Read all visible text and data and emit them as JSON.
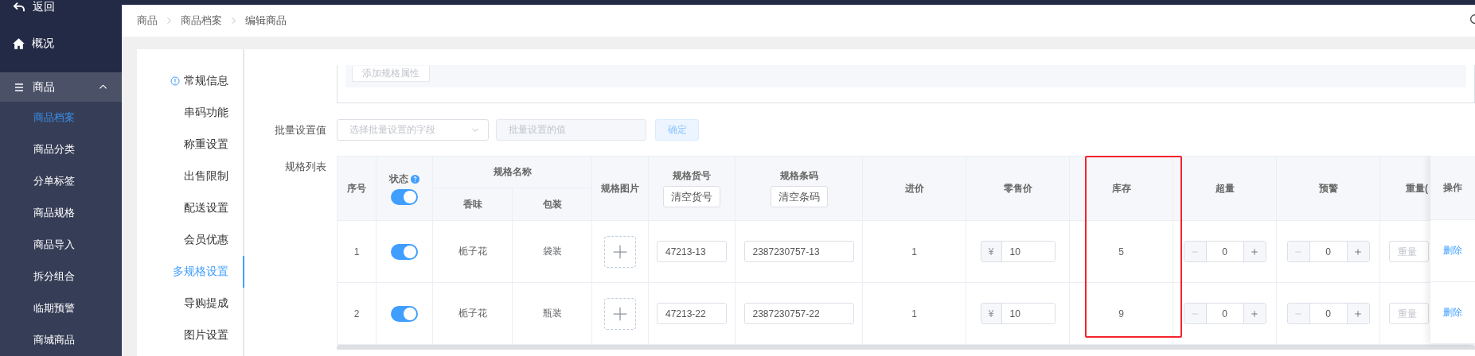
{
  "sidebar": {
    "back": "返回",
    "overview": "概况",
    "group": {
      "label": "商品",
      "expanded": true,
      "items": [
        {
          "label": "商品档案",
          "selected": true
        },
        {
          "label": "商品分类",
          "selected": false
        },
        {
          "label": "分单标签",
          "selected": false
        },
        {
          "label": "商品规格",
          "selected": false
        },
        {
          "label": "商品导入",
          "selected": false
        },
        {
          "label": "拆分组合",
          "selected": false
        },
        {
          "label": "临期预警",
          "selected": false
        },
        {
          "label": "商城商品",
          "selected": false
        }
      ]
    }
  },
  "breadcrumb": [
    "商品",
    "商品档案",
    "编辑商品"
  ],
  "section_nav": [
    {
      "label": "常规信息",
      "selected": false,
      "alert": true
    },
    {
      "label": "串码功能",
      "selected": false,
      "alert": false
    },
    {
      "label": "称重设置",
      "selected": false,
      "alert": false
    },
    {
      "label": "出售限制",
      "selected": false,
      "alert": false
    },
    {
      "label": "配送设置",
      "selected": false,
      "alert": false
    },
    {
      "label": "会员优惠",
      "selected": false,
      "alert": false
    },
    {
      "label": "多规格设置",
      "selected": true,
      "alert": false
    },
    {
      "label": "导购提成",
      "selected": false,
      "alert": false
    },
    {
      "label": "图片设置",
      "selected": false,
      "alert": false
    }
  ],
  "spec_attributes": {
    "add_button": "添加规格属性"
  },
  "batch": {
    "label": "批量设置值",
    "field_placeholder": "选择批量设置的字段",
    "value_placeholder": "批量设置的值",
    "confirm": "确定"
  },
  "spec_table": {
    "label": "规格列表",
    "header_rows": [
      [
        {
          "kind": "plain",
          "label": "序号",
          "rowspan": 2
        },
        {
          "kind": "toggle",
          "label": "状态",
          "on": true,
          "rowspan": 2
        },
        {
          "kind": "plain",
          "label": "规格名称",
          "colspan": 2
        },
        {
          "kind": "plain",
          "label": "规格图片",
          "rowspan": 2
        },
        {
          "kind": "action",
          "label": "规格货号",
          "button": "清空货号",
          "rowspan": 2
        },
        {
          "kind": "action",
          "label": "规格条码",
          "button": "清空条码",
          "rowspan": 2
        },
        {
          "kind": "plain",
          "label": "进价",
          "rowspan": 2
        },
        {
          "kind": "plain",
          "label": "零售价",
          "rowspan": 2
        },
        {
          "kind": "plain",
          "label": "库存",
          "rowspan": 2,
          "highlighted": true
        },
        {
          "kind": "plain",
          "label": "超量",
          "rowspan": 2
        },
        {
          "kind": "plain",
          "label": "预警",
          "rowspan": 2
        },
        {
          "kind": "plain",
          "label": "重量(",
          "rowspan": 2
        }
      ],
      [
        {
          "kind": "plain",
          "label": "香味"
        },
        {
          "kind": "plain",
          "label": "包装"
        }
      ]
    ],
    "action_column": "操作",
    "rows": [
      {
        "cells": [
          {
            "kind": "text",
            "text": "1"
          },
          {
            "kind": "toggle",
            "on": true
          },
          {
            "kind": "text",
            "text": "栀子花"
          },
          {
            "kind": "text",
            "text": "袋装"
          },
          {
            "kind": "upload"
          },
          {
            "kind": "input",
            "value": "47213-13"
          },
          {
            "kind": "input",
            "value": "2387230757-13"
          },
          {
            "kind": "text",
            "text": "1"
          },
          {
            "kind": "price",
            "currency": "¥",
            "value": "10"
          },
          {
            "kind": "text",
            "text": "5"
          },
          {
            "kind": "stepper",
            "value": "0"
          },
          {
            "kind": "stepper",
            "value": "0"
          },
          {
            "kind": "input",
            "placeholder": "重量"
          }
        ],
        "action": "删除"
      },
      {
        "cells": [
          {
            "kind": "text",
            "text": "2"
          },
          {
            "kind": "toggle",
            "on": true
          },
          {
            "kind": "text",
            "text": "栀子花"
          },
          {
            "kind": "text",
            "text": "瓶装"
          },
          {
            "kind": "upload"
          },
          {
            "kind": "input",
            "value": "47213-22"
          },
          {
            "kind": "input",
            "value": "2387230757-22"
          },
          {
            "kind": "text",
            "text": "1"
          },
          {
            "kind": "price",
            "currency": "¥",
            "value": "10"
          },
          {
            "kind": "text",
            "text": "9"
          },
          {
            "kind": "stepper",
            "value": "0"
          },
          {
            "kind": "stepper",
            "value": "0"
          },
          {
            "kind": "input",
            "placeholder": "重量"
          }
        ],
        "action": "删除"
      }
    ]
  }
}
